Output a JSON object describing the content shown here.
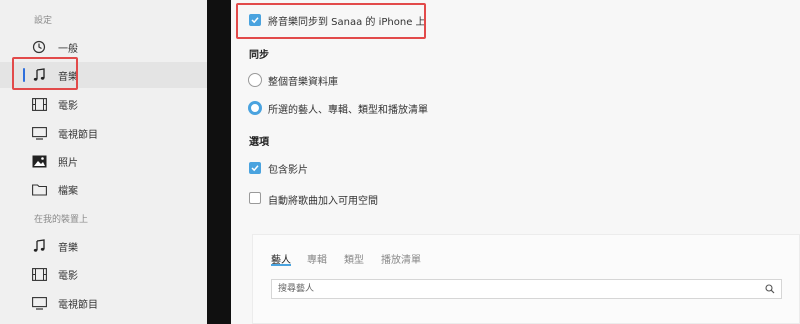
{
  "sidebar": {
    "section_settings": "設定",
    "settings_items": [
      {
        "label": "一般",
        "icon": "gear-icon"
      },
      {
        "label": "音樂",
        "icon": "music-note-icon",
        "selected": true
      },
      {
        "label": "電影",
        "icon": "film-icon"
      },
      {
        "label": "電視節目",
        "icon": "tv-icon"
      },
      {
        "label": "照片",
        "icon": "photo-icon"
      },
      {
        "label": "檔案",
        "icon": "folder-icon"
      }
    ],
    "section_on_device": "在我的裝置上",
    "device_items": [
      {
        "label": "音樂",
        "icon": "music-note-icon"
      },
      {
        "label": "電影",
        "icon": "film-icon"
      },
      {
        "label": "電視節目",
        "icon": "tv-icon"
      }
    ]
  },
  "main": {
    "sync_checkbox_label": "將音樂同步到 Sanaa 的 iPhone 上",
    "sync_checked": true,
    "sync_heading": "同步",
    "radio_entire_library": "整個音樂資料庫",
    "radio_selected": "所選的藝人、專輯、類型和播放清單",
    "selected_option": "radio_selected",
    "options_heading": "選項",
    "include_videos": "包含影片",
    "include_videos_checked": true,
    "auto_fill": "自動將歌曲加入可用空間",
    "auto_fill_checked": false,
    "tabs": [
      "藝人",
      "專輯",
      "類型",
      "播放清單"
    ],
    "active_tab": "藝人",
    "search_placeholder": "搜尋藝人"
  },
  "colors": {
    "accent": "#4aa3df",
    "highlight_box": "#e24a4a",
    "selection_bar": "#2f6fdc"
  }
}
